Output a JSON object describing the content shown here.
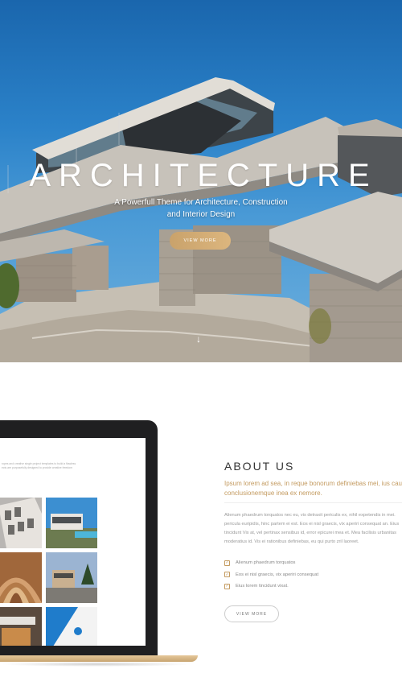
{
  "hero": {
    "title": "ARCHITECTURE",
    "subtitle_line1": "A Powerfull Theme for Architecture, Construction",
    "subtitle_line2": "and Interior Design",
    "button": "VIEW MORE",
    "scroll_icon": "arrow-down-icon"
  },
  "laptop": {
    "screen_text_line1": "ropes and creative single project templates to build a flawless",
    "screen_text_line2": "ects are purposefully designed to provide creative freedom"
  },
  "about": {
    "title": "ABOUT US",
    "lead_line1": "Ipsum lorem ad sea, in reque bonorum definiebas mei, ius causa",
    "lead_line2": "conclusionemque inea ex nemore.",
    "body_lines": [
      "Alienum phaedrum torquatos nec eu, vis detraxit periculis ex, nihil expetendis in mei.",
      "pericula euripidis, hinc partem ei est. Eos ei nisl graecis, vix aperiri consequat an. Eius",
      "tincidunt Vix at, vel pertinax sensibus id, error epicurei mea et. Mea facilisis urbanitas",
      "moderatius id. Vis ei rationibus definiebas, eu qui purto zril laoreet."
    ],
    "checklist": [
      "Alienum phaedrum torquatos",
      "Eos ei nisl graecis, vix aperiri consequat",
      "Eius lorem tincidunt vixat."
    ],
    "button": "VIEW MORE"
  },
  "colors": {
    "accent": "#c39a5f",
    "sky": "#2b82c9"
  }
}
